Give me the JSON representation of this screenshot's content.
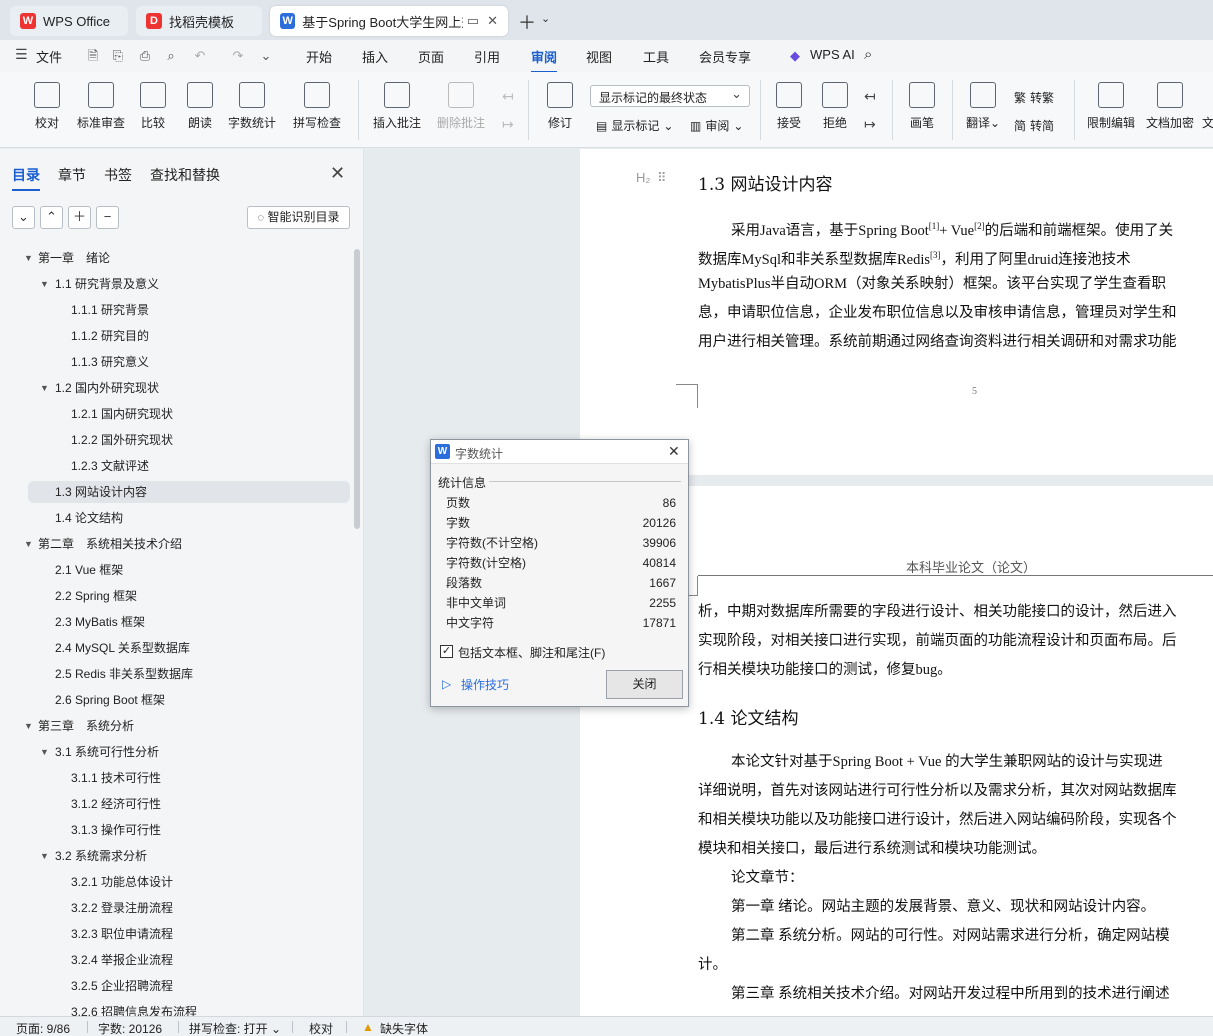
{
  "tabs": [
    {
      "label": "WPS Office",
      "logo": "W"
    },
    {
      "label": "找稻壳模板",
      "logo": "D"
    },
    {
      "label": "基于Spring Boot大学生网上兼职",
      "logo": "W"
    }
  ],
  "menubar": {
    "file": "文件",
    "items": [
      "开始",
      "插入",
      "页面",
      "引用",
      "审阅",
      "视图",
      "工具",
      "会员专享"
    ],
    "active": "审阅",
    "ai": "WPS AI"
  },
  "ribbon": {
    "buttons": [
      "校对",
      "标准审查",
      "比较",
      "朗读",
      "字数统计",
      "拼写检查",
      "插入批注",
      "删除批注",
      "修订",
      "接受",
      "拒绝",
      "画笔",
      "限制编辑",
      "文档加密",
      "文"
    ],
    "markup_state": "显示标记的最终状态",
    "show_markup": "显示标记",
    "review": "审阅",
    "translate": "翻译",
    "to_traditional": "转繁",
    "to_simplified": "转简"
  },
  "sidebar": {
    "tabs": [
      "目录",
      "章节",
      "书签",
      "查找和替换"
    ],
    "smart_button": "智能识别目录",
    "toc": [
      {
        "label": "第一章　绪论",
        "level": 0,
        "arrow": true
      },
      {
        "label": "1.1 研究背景及意义",
        "level": 1,
        "arrow": true
      },
      {
        "label": "1.1.1 研究背景",
        "level": 2,
        "arrow": false
      },
      {
        "label": "1.1.2 研究目的",
        "level": 2,
        "arrow": false
      },
      {
        "label": "1.1.3 研究意义",
        "level": 2,
        "arrow": false
      },
      {
        "label": "1.2 国内外研究现状",
        "level": 1,
        "arrow": true
      },
      {
        "label": "1.2.1 国内研究现状",
        "level": 2,
        "arrow": false
      },
      {
        "label": "1.2.2 国外研究现状",
        "level": 2,
        "arrow": false
      },
      {
        "label": "1.2.3 文献评述",
        "level": 2,
        "arrow": false
      },
      {
        "label": "1.3  网站设计内容",
        "level": 1,
        "arrow": false,
        "selected": true
      },
      {
        "label": "1.4  论文结构",
        "level": 1,
        "arrow": false
      },
      {
        "label": "第二章　系统相关技术介绍",
        "level": 0,
        "arrow": true
      },
      {
        "label": "2.1 Vue 框架",
        "level": 1,
        "arrow": false
      },
      {
        "label": "2.2 Spring 框架",
        "level": 1,
        "arrow": false
      },
      {
        "label": "2.3 MyBatis 框架",
        "level": 1,
        "arrow": false
      },
      {
        "label": "2.4 MySQL 关系型数据库",
        "level": 1,
        "arrow": false
      },
      {
        "label": "2.5 Redis 非关系型数据库",
        "level": 1,
        "arrow": false
      },
      {
        "label": "2.6 Spring Boot 框架",
        "level": 1,
        "arrow": false
      },
      {
        "label": "第三章　系统分析",
        "level": 0,
        "arrow": true
      },
      {
        "label": "3.1  系统可行性分析",
        "level": 1,
        "arrow": true
      },
      {
        "label": "3.1.1  技术可行性",
        "level": 2,
        "arrow": false
      },
      {
        "label": "3.1.2  经济可行性",
        "level": 2,
        "arrow": false
      },
      {
        "label": "3.1.3  操作可行性",
        "level": 2,
        "arrow": false
      },
      {
        "label": "3.2  系统需求分析",
        "level": 1,
        "arrow": true
      },
      {
        "label": "3.2.1  功能总体设计",
        "level": 2,
        "arrow": false
      },
      {
        "label": "3.2.2  登录注册流程",
        "level": 2,
        "arrow": false
      },
      {
        "label": "3.2.3  职位申请流程",
        "level": 2,
        "arrow": false
      },
      {
        "label": "3.2.4  举报企业流程",
        "level": 2,
        "arrow": false
      },
      {
        "label": "3.2.5  企业招聘流程",
        "level": 2,
        "arrow": false
      },
      {
        "label": "3.2.6  招聘信息发布流程",
        "level": 2,
        "arrow": false
      }
    ]
  },
  "document": {
    "heading1": "1.3  网站设计内容",
    "heading_marker": "H₂",
    "p1": [
      "采用Java语言，基于Spring Boot",
      "数据库MySql和非关系型数据库Redis",
      "MybatisPlus半自动ORM（对象关系映射）框架。该平台实现了学生查看职",
      "息，申请职位信息，企业发布职位信息以及审核申请信息，管理员对学生和",
      "用户进行相关管理。系统前期通过网络查询资料进行相关调研和对需求功能"
    ],
    "p1_line1_rest": "的后端和前端框架。使用了关",
    "p1_line1_sup1": "[1]",
    "p1_line1_vue": "+ Vue",
    "p1_line1_sup2": "[2]",
    "p1_line2_sup": "[3]",
    "p1_line2_rest": "，利用了阿里druid连接池技术",
    "page_number": "5",
    "header_text": "本科毕业论文（论文）",
    "p2": [
      "析，中期对数据库所需要的字段进行设计、相关功能接口的设计，然后进入",
      "实现阶段，对相关接口进行实现，前端页面的功能流程设计和页面布局。后",
      "行相关模块功能接口的测试，修复bug。"
    ],
    "heading2": "1.4  论文结构",
    "p3": [
      "本论文针对基于Spring Boot + Vue  的大学生兼职网站的设计与实现进",
      "详细说明，首先对该网站进行可行性分析以及需求分析，其次对网站数据库",
      "和相关模块功能以及功能接口进行设计，然后进入网站编码阶段，实现各个",
      "模块和相关接口，最后进行系统测试和模块功能测试。",
      "论文章节：",
      "第一章  绪论。网站主题的发展背景、意义、现状和网站设计内容。",
      "第二章  系统分析。网站的可行性。对网站需求进行分析，确定网站模",
      "计。",
      "第三章  系统相关技术介绍。对网站开发过程中所用到的技术进行阐述"
    ]
  },
  "dialog": {
    "title": "字数统计",
    "section": "统计信息",
    "stats": [
      {
        "label": "页数",
        "value": "86"
      },
      {
        "label": "字数",
        "value": "20126"
      },
      {
        "label": "字符数(不计空格)",
        "value": "39906"
      },
      {
        "label": "字符数(计空格)",
        "value": "40814"
      },
      {
        "label": "段落数",
        "value": "1667"
      },
      {
        "label": "非中文单词",
        "value": "2255"
      },
      {
        "label": "中文字符",
        "value": "17871"
      }
    ],
    "checkbox_label": "包括文本框、脚注和尾注(F)",
    "checkbox_checked": true,
    "tips": "操作技巧",
    "close": "关闭"
  },
  "statusbar": {
    "page": "页面: 9/86",
    "words": "字数: 20126",
    "spell": "拼写检查: 打开",
    "proof": "校对",
    "missing_font": "缺失字体"
  }
}
